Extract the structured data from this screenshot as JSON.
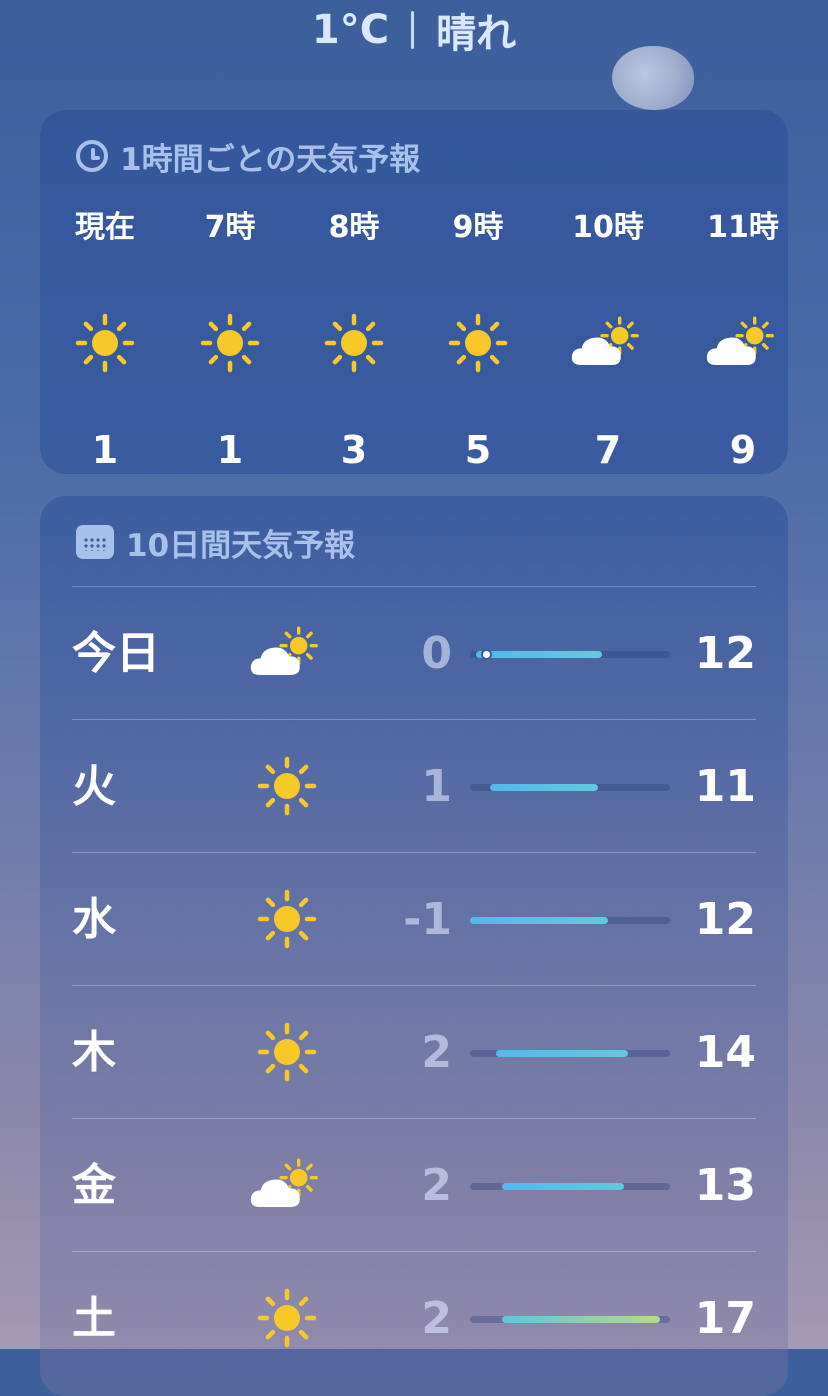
{
  "header": {
    "temp": "1°C",
    "condition": "晴れ"
  },
  "hourly": {
    "title": "1時間ごとの天気予報",
    "items": [
      {
        "time": "現在",
        "icon": "sun-icon",
        "temp": "1"
      },
      {
        "time": "7時",
        "icon": "sun-icon",
        "temp": "1"
      },
      {
        "time": "8時",
        "icon": "sun-icon",
        "temp": "3"
      },
      {
        "time": "9時",
        "icon": "sun-icon",
        "temp": "5"
      },
      {
        "time": "10時",
        "icon": "partly-cloudy-icon",
        "temp": "7"
      },
      {
        "time": "11時",
        "icon": "partly-cloudy-icon",
        "temp": "9"
      }
    ]
  },
  "daily": {
    "title": "10日間天気予報",
    "items": [
      {
        "day": "今日",
        "icon": "partly-cloudy-icon",
        "low": "0",
        "high": "12",
        "bar_start": 0.03,
        "bar_end": 0.66,
        "current": 0.08
      },
      {
        "day": "火",
        "icon": "sun-icon",
        "low": "1",
        "high": "11",
        "bar_start": 0.1,
        "bar_end": 0.64
      },
      {
        "day": "水",
        "icon": "sun-icon",
        "low": "-1",
        "high": "12",
        "bar_start": 0.0,
        "bar_end": 0.69
      },
      {
        "day": "木",
        "icon": "sun-icon",
        "low": "2",
        "high": "14",
        "bar_start": 0.13,
        "bar_end": 0.79
      },
      {
        "day": "金",
        "icon": "partly-cloudy-icon",
        "low": "2",
        "high": "13",
        "bar_start": 0.16,
        "bar_end": 0.77
      },
      {
        "day": "土",
        "icon": "sun-icon",
        "low": "2",
        "high": "17",
        "bar_start": 0.16,
        "bar_end": 0.95
      }
    ]
  }
}
